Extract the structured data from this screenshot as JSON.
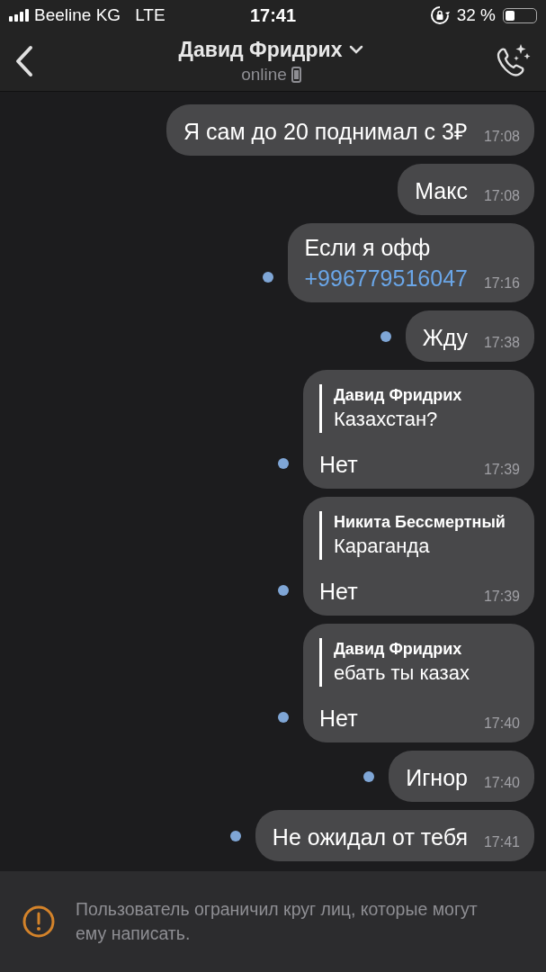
{
  "status_bar": {
    "carrier": "Beeline KG",
    "network": "LTE",
    "time": "17:41",
    "battery_percent": "32 %"
  },
  "header": {
    "title": "Давид Фридрих",
    "subtitle": "online"
  },
  "messages": [
    {
      "text": "Я сам до 20 поднимал с 3₽",
      "time": "17:08",
      "unread": false
    },
    {
      "text": "Макс",
      "time": "17:08",
      "unread": false
    },
    {
      "text": "Если я офф",
      "link": "+996779516047",
      "time": "17:16",
      "unread": true
    },
    {
      "text": "Жду",
      "time": "17:38",
      "unread": true
    },
    {
      "reply": {
        "author": "Давид Фридрих",
        "text": "Казахстан?"
      },
      "text": "Нет",
      "time": "17:39",
      "unread": true
    },
    {
      "reply": {
        "author": "Никита Бессмертный",
        "text": "Караганда"
      },
      "text": "Нет",
      "time": "17:39",
      "unread": true
    },
    {
      "reply": {
        "author": "Давид Фридрих",
        "text": "ебать ты казах"
      },
      "text": "Нет",
      "time": "17:40",
      "unread": true
    },
    {
      "text": "Игнор",
      "time": "17:40",
      "unread": true
    },
    {
      "text": "Не ожидал от тебя",
      "time": "17:41",
      "unread": true
    }
  ],
  "notice": "Пользователь ограничил круг лиц, которые могут ему написать."
}
